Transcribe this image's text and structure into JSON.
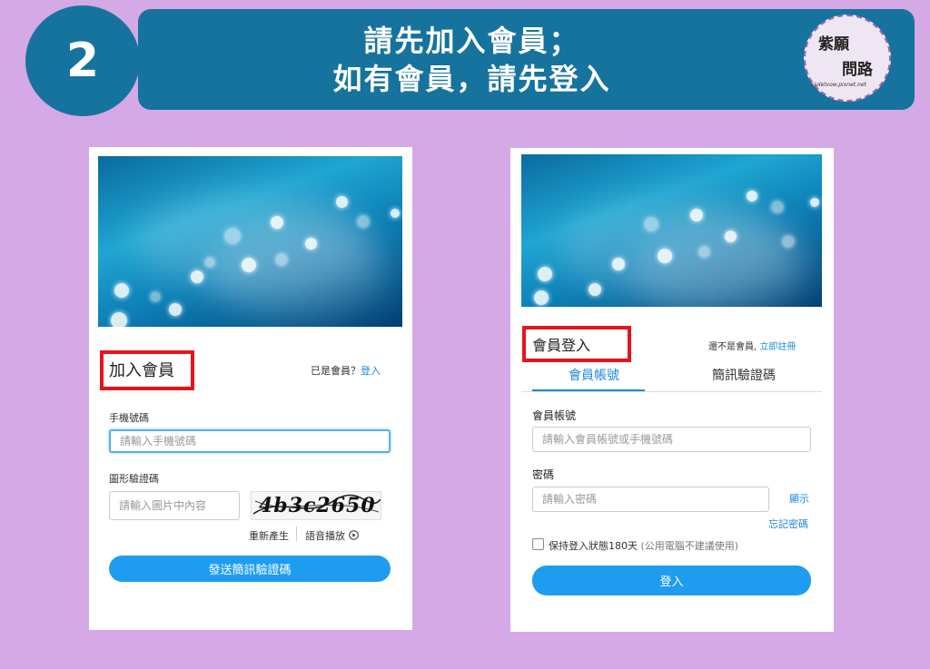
{
  "header": {
    "step_number": "2",
    "title_line1": "請先加入會員；",
    "title_line2": "如有會員，請先登入",
    "badge_line1": "紫願",
    "badge_line2": "問路",
    "badge_url": "violetvow.pixnet.net"
  },
  "signup": {
    "heading": "加入會員",
    "have_account_text": "已是會員？",
    "login_link": "登入",
    "phone_label": "手機號碼",
    "phone_placeholder": "請輸入手機號碼",
    "captcha_label": "圖形驗證碼",
    "captcha_placeholder": "請輸入圖片中內容",
    "captcha_image_text": "4b3c2650",
    "regenerate_label": "重新產生",
    "audio_label": "語音播放",
    "send_button": "發送簡訊驗證碼"
  },
  "login": {
    "heading": "會員登入",
    "not_member_text": "還不是會員,",
    "register_link": "立即註冊",
    "tabs": [
      "會員帳號",
      "簡訊驗證碼"
    ],
    "account_label": "會員帳號",
    "account_placeholder": "請輸入會員帳號或手機號碼",
    "password_label": "密碼",
    "password_placeholder": "請輸入密碼",
    "show_label": "顯示",
    "forgot_label": "忘記密碼",
    "remember_label": "保持登入狀態180天",
    "remember_note": "(公用電腦不建議使用)",
    "login_button": "登入"
  },
  "colors": {
    "background": "#d4a9e6",
    "banner": "#16739e",
    "highlight": "#e8141b",
    "primary_button": "#1e9cf0",
    "link": "#1e88d8"
  }
}
